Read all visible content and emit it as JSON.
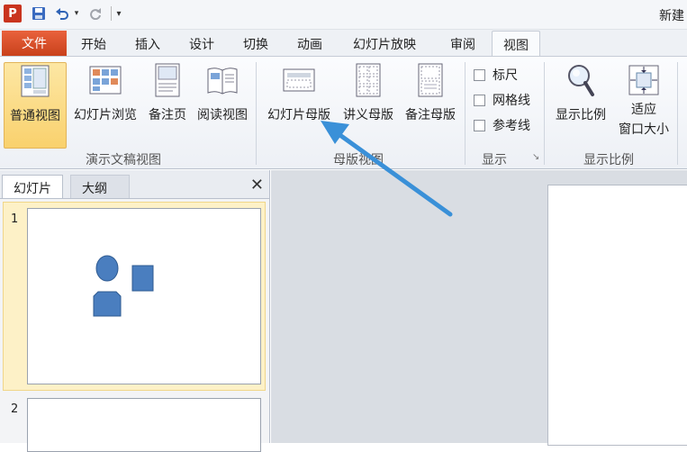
{
  "titlebar": {
    "app_icon": "P",
    "save_icon": "save-icon",
    "undo_icon": "undo-icon",
    "redo_icon": "redo-icon",
    "document_title": "新建"
  },
  "tabs": {
    "file": "文件",
    "items": [
      "开始",
      "插入",
      "设计",
      "切换",
      "动画",
      "幻灯片放映",
      "审阅",
      "视图"
    ],
    "active": "视图"
  },
  "ribbon": {
    "presentation_views": {
      "label": "演示文稿视图",
      "buttons": [
        "普通视图",
        "幻灯片浏览",
        "备注页",
        "阅读视图"
      ],
      "active": "普通视图"
    },
    "master_views": {
      "label": "母版视图",
      "buttons": [
        "幻灯片母版",
        "讲义母版",
        "备注母版"
      ]
    },
    "show": {
      "label": "显示",
      "checkboxes": [
        {
          "label": "标尺",
          "checked": false
        },
        {
          "label": "网格线",
          "checked": false
        },
        {
          "label": "参考线",
          "checked": false
        }
      ]
    },
    "zoom": {
      "label": "显示比例",
      "zoom_button": "显示比例",
      "fit_button_line1": "适应",
      "fit_button_line2": "窗口大小"
    }
  },
  "left_panel": {
    "tab_slides": "幻灯片",
    "tab_outline": "大纲",
    "slide_numbers": [
      "1",
      "2"
    ]
  },
  "colors": {
    "file_tab": "#d4512a",
    "shape_fill": "#4a7ebf",
    "arrow": "#3a90d8",
    "selection": "#fdf1c7"
  }
}
